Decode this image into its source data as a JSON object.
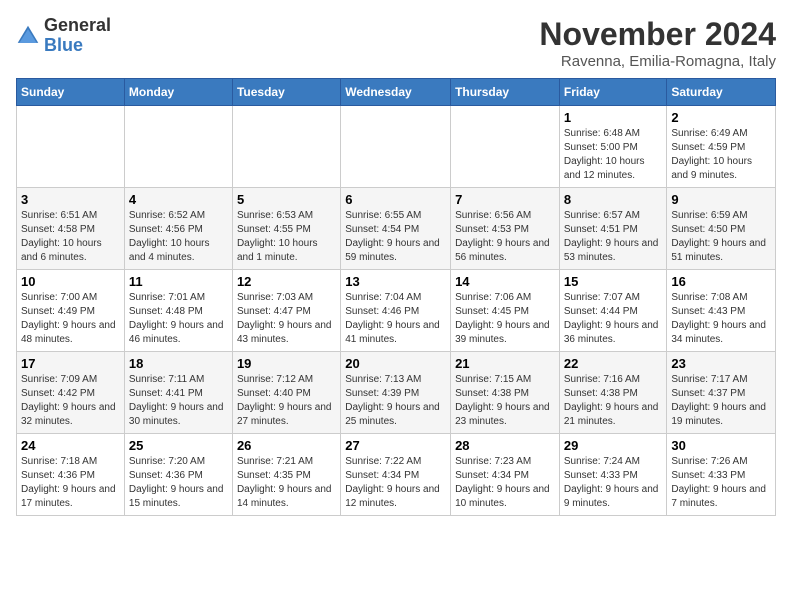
{
  "header": {
    "logo_general": "General",
    "logo_blue": "Blue",
    "month_title": "November 2024",
    "location": "Ravenna, Emilia-Romagna, Italy"
  },
  "columns": [
    "Sunday",
    "Monday",
    "Tuesday",
    "Wednesday",
    "Thursday",
    "Friday",
    "Saturday"
  ],
  "weeks": [
    [
      {
        "day": "",
        "info": ""
      },
      {
        "day": "",
        "info": ""
      },
      {
        "day": "",
        "info": ""
      },
      {
        "day": "",
        "info": ""
      },
      {
        "day": "",
        "info": ""
      },
      {
        "day": "1",
        "info": "Sunrise: 6:48 AM\nSunset: 5:00 PM\nDaylight: 10 hours and 12 minutes."
      },
      {
        "day": "2",
        "info": "Sunrise: 6:49 AM\nSunset: 4:59 PM\nDaylight: 10 hours and 9 minutes."
      }
    ],
    [
      {
        "day": "3",
        "info": "Sunrise: 6:51 AM\nSunset: 4:58 PM\nDaylight: 10 hours and 6 minutes."
      },
      {
        "day": "4",
        "info": "Sunrise: 6:52 AM\nSunset: 4:56 PM\nDaylight: 10 hours and 4 minutes."
      },
      {
        "day": "5",
        "info": "Sunrise: 6:53 AM\nSunset: 4:55 PM\nDaylight: 10 hours and 1 minute."
      },
      {
        "day": "6",
        "info": "Sunrise: 6:55 AM\nSunset: 4:54 PM\nDaylight: 9 hours and 59 minutes."
      },
      {
        "day": "7",
        "info": "Sunrise: 6:56 AM\nSunset: 4:53 PM\nDaylight: 9 hours and 56 minutes."
      },
      {
        "day": "8",
        "info": "Sunrise: 6:57 AM\nSunset: 4:51 PM\nDaylight: 9 hours and 53 minutes."
      },
      {
        "day": "9",
        "info": "Sunrise: 6:59 AM\nSunset: 4:50 PM\nDaylight: 9 hours and 51 minutes."
      }
    ],
    [
      {
        "day": "10",
        "info": "Sunrise: 7:00 AM\nSunset: 4:49 PM\nDaylight: 9 hours and 48 minutes."
      },
      {
        "day": "11",
        "info": "Sunrise: 7:01 AM\nSunset: 4:48 PM\nDaylight: 9 hours and 46 minutes."
      },
      {
        "day": "12",
        "info": "Sunrise: 7:03 AM\nSunset: 4:47 PM\nDaylight: 9 hours and 43 minutes."
      },
      {
        "day": "13",
        "info": "Sunrise: 7:04 AM\nSunset: 4:46 PM\nDaylight: 9 hours and 41 minutes."
      },
      {
        "day": "14",
        "info": "Sunrise: 7:06 AM\nSunset: 4:45 PM\nDaylight: 9 hours and 39 minutes."
      },
      {
        "day": "15",
        "info": "Sunrise: 7:07 AM\nSunset: 4:44 PM\nDaylight: 9 hours and 36 minutes."
      },
      {
        "day": "16",
        "info": "Sunrise: 7:08 AM\nSunset: 4:43 PM\nDaylight: 9 hours and 34 minutes."
      }
    ],
    [
      {
        "day": "17",
        "info": "Sunrise: 7:09 AM\nSunset: 4:42 PM\nDaylight: 9 hours and 32 minutes."
      },
      {
        "day": "18",
        "info": "Sunrise: 7:11 AM\nSunset: 4:41 PM\nDaylight: 9 hours and 30 minutes."
      },
      {
        "day": "19",
        "info": "Sunrise: 7:12 AM\nSunset: 4:40 PM\nDaylight: 9 hours and 27 minutes."
      },
      {
        "day": "20",
        "info": "Sunrise: 7:13 AM\nSunset: 4:39 PM\nDaylight: 9 hours and 25 minutes."
      },
      {
        "day": "21",
        "info": "Sunrise: 7:15 AM\nSunset: 4:38 PM\nDaylight: 9 hours and 23 minutes."
      },
      {
        "day": "22",
        "info": "Sunrise: 7:16 AM\nSunset: 4:38 PM\nDaylight: 9 hours and 21 minutes."
      },
      {
        "day": "23",
        "info": "Sunrise: 7:17 AM\nSunset: 4:37 PM\nDaylight: 9 hours and 19 minutes."
      }
    ],
    [
      {
        "day": "24",
        "info": "Sunrise: 7:18 AM\nSunset: 4:36 PM\nDaylight: 9 hours and 17 minutes."
      },
      {
        "day": "25",
        "info": "Sunrise: 7:20 AM\nSunset: 4:36 PM\nDaylight: 9 hours and 15 minutes."
      },
      {
        "day": "26",
        "info": "Sunrise: 7:21 AM\nSunset: 4:35 PM\nDaylight: 9 hours and 14 minutes."
      },
      {
        "day": "27",
        "info": "Sunrise: 7:22 AM\nSunset: 4:34 PM\nDaylight: 9 hours and 12 minutes."
      },
      {
        "day": "28",
        "info": "Sunrise: 7:23 AM\nSunset: 4:34 PM\nDaylight: 9 hours and 10 minutes."
      },
      {
        "day": "29",
        "info": "Sunrise: 7:24 AM\nSunset: 4:33 PM\nDaylight: 9 hours and 9 minutes."
      },
      {
        "day": "30",
        "info": "Sunrise: 7:26 AM\nSunset: 4:33 PM\nDaylight: 9 hours and 7 minutes."
      }
    ]
  ]
}
